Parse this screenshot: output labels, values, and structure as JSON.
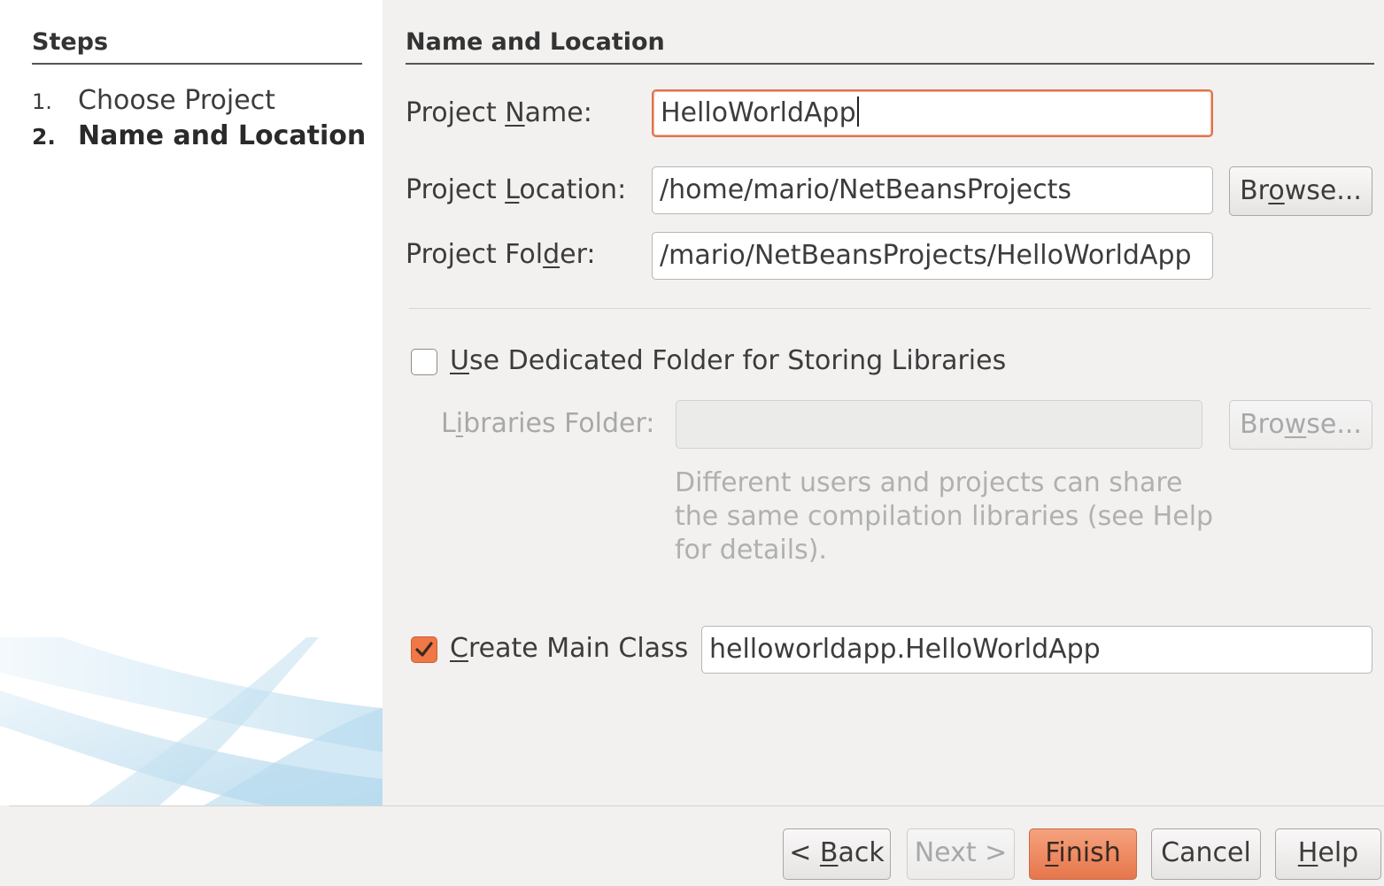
{
  "steps": {
    "title": "Steps",
    "items": [
      {
        "num": "1.",
        "label": "Choose Project"
      },
      {
        "num": "2.",
        "label": "Name and Location"
      }
    ]
  },
  "panel": {
    "title": "Name and Location",
    "project_name": {
      "label_pre": "Project ",
      "label_u": "N",
      "label_post": "ame:",
      "value": "HelloWorldApp"
    },
    "project_location": {
      "label_pre": "Project ",
      "label_u": "L",
      "label_post": "ocation:",
      "value": "/home/mario/NetBeansProjects",
      "browse_pre": "Br",
      "browse_u": "o",
      "browse_post": "wse..."
    },
    "project_folder": {
      "label_pre": "Project Fol",
      "label_u": "d",
      "label_post": "er:",
      "value": "/mario/NetBeansProjects/HelloWorldApp"
    },
    "dedicated_folder": {
      "label_u": "U",
      "label_post": "se Dedicated Folder for Storing Libraries",
      "checked": false
    },
    "libraries_folder": {
      "label_pre": "L",
      "label_u": "i",
      "label_post": "braries Folder:",
      "value": "",
      "browse_pre": "Bro",
      "browse_u": "w",
      "browse_post": "se..."
    },
    "hint": "Different users and projects can share the same compilation libraries (see Help for details).",
    "main_class": {
      "label_u": "C",
      "label_post": "reate Main Class",
      "checked": true,
      "value": "helloworldapp.HelloWorldApp"
    }
  },
  "footer": {
    "back_pre": "< ",
    "back_u": "B",
    "back_post": "ack",
    "next": "Next >",
    "finish_u": "F",
    "finish_post": "inish",
    "cancel": "Cancel",
    "help_u": "H",
    "help_post": "elp"
  },
  "colors": {
    "accent": "#e6764b",
    "focus_border": "#e0734a",
    "disabled_text": "#a8a8a8"
  }
}
